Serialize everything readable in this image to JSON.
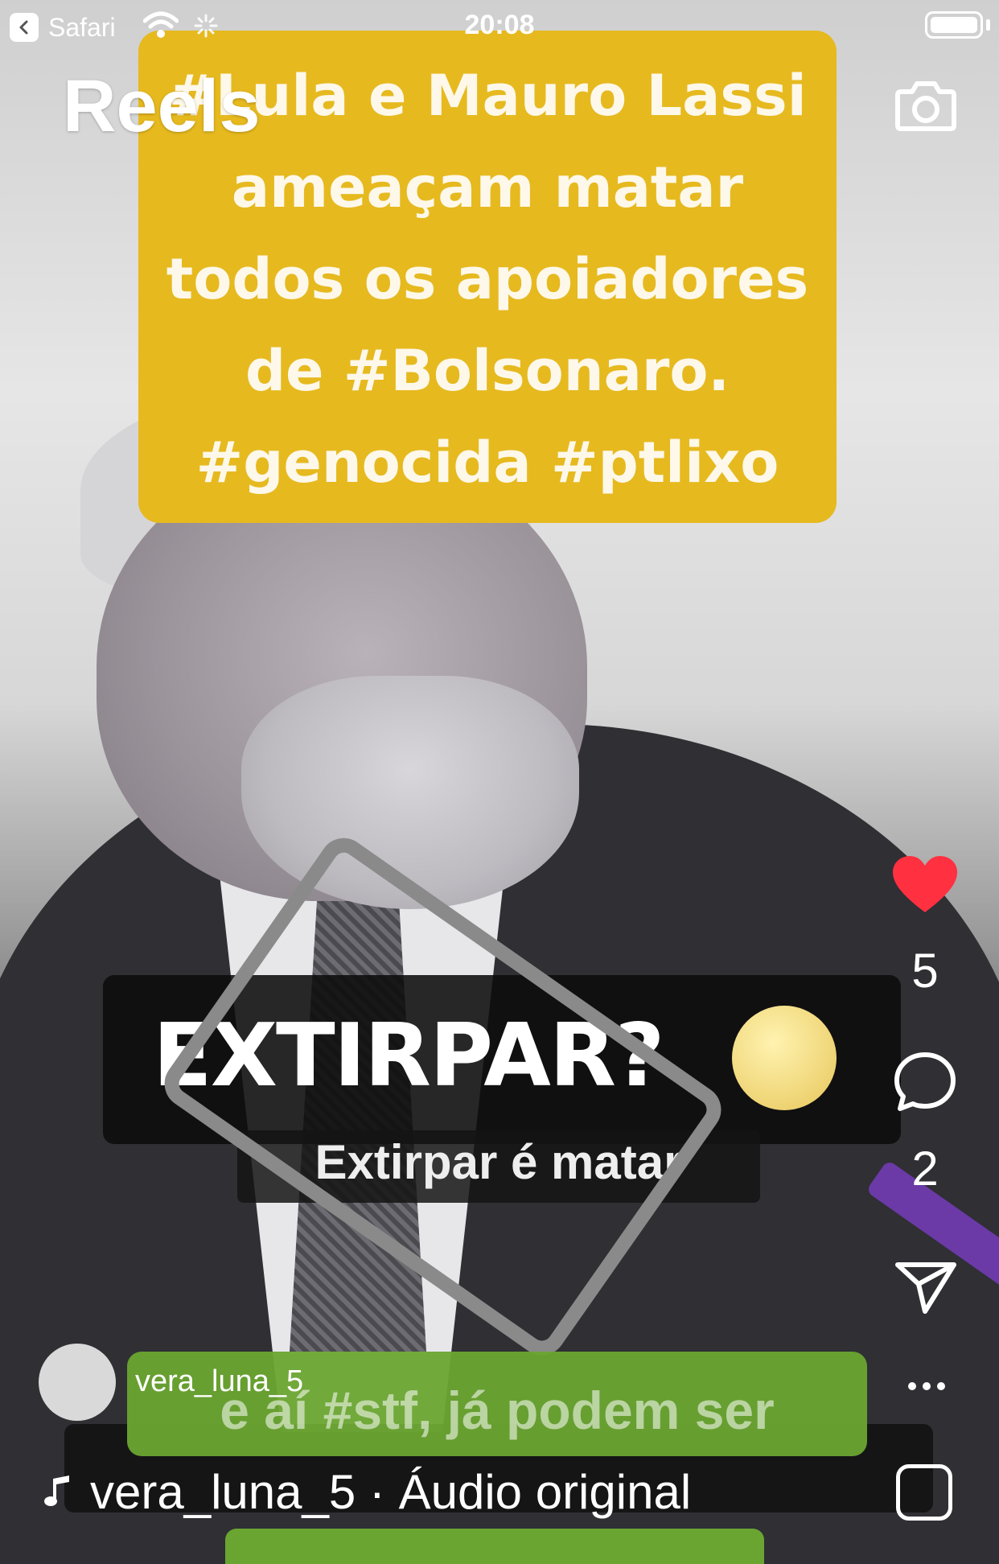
{
  "status_bar": {
    "back_app": "Safari",
    "time": "20:08"
  },
  "header": {
    "title": "Reels",
    "camera_icon": "camera-icon"
  },
  "video": {
    "caption": "#Lula  e Mauro Lassi\nameaçam matar\ntodos os apoiadores\nde #Bolsonaro.\n#genocida #ptlixo",
    "overlay_big": "EXTIRPAR?",
    "overlay_sub": "Extirpar é matar",
    "overlay_green": "e aí #stf, já podem ser"
  },
  "actions": {
    "like_count": "5",
    "comment_count": "2",
    "like_color": "#ff3040"
  },
  "post": {
    "username": "vera_luna_5",
    "audio": "vera_luna_5 · Áudio original"
  }
}
